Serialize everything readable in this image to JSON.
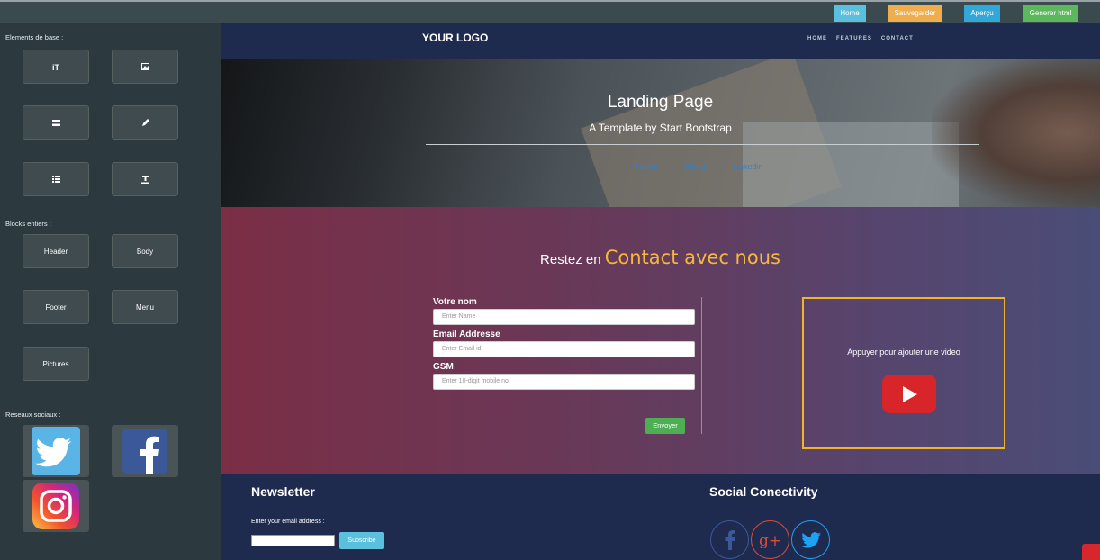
{
  "toolbar": {
    "home": "Home",
    "save": "Sauvegarder",
    "preview": "Aperçu",
    "generate": "Generer html"
  },
  "sidebar": {
    "base_title": "Elements de base :",
    "blocks_title": "Blocks entiers :",
    "social_title": "Reseaux sociaux :",
    "blocks": [
      "Header",
      "Body",
      "Footer",
      "Menu",
      "Pictures"
    ],
    "base_icons": [
      "text-size-icon",
      "image-icon",
      "divider-icon",
      "pencil-icon",
      "list-icon",
      "text-underline-icon"
    ]
  },
  "nav": {
    "logo": "YOUR LOGO",
    "links": [
      "HOME",
      "FEATURES",
      "CONTACT"
    ]
  },
  "hero": {
    "title": "Landing Page",
    "subtitle": "A Template by Start Bootstrap",
    "links": [
      "Twitter",
      "Github",
      "Linkedin"
    ]
  },
  "contact": {
    "heading_prefix": "Restez en",
    "heading_highlight": "Contact avec nous",
    "name_label": "Votre nom",
    "name_placeholder": "Enter Name",
    "email_label": "Email Addresse",
    "email_placeholder": "Enter Email id",
    "phone_label": "GSM",
    "phone_placeholder": "Enter 10-digit mobile no.",
    "send_label": "Envoyer",
    "video_text": "Appuyer pour ajouter une video"
  },
  "footer": {
    "newsletter_title": "Newsletter",
    "email_label": "Enter your email address :",
    "subscribe_label": "Subscribe",
    "social_title": "Social Conectivity"
  },
  "colors": {
    "home_btn": "#5bc0de",
    "save_btn": "#f0ad4e",
    "preview_btn": "#31a8d8",
    "generate_btn": "#5cb85c",
    "accent_heading": "#f6b83c"
  }
}
